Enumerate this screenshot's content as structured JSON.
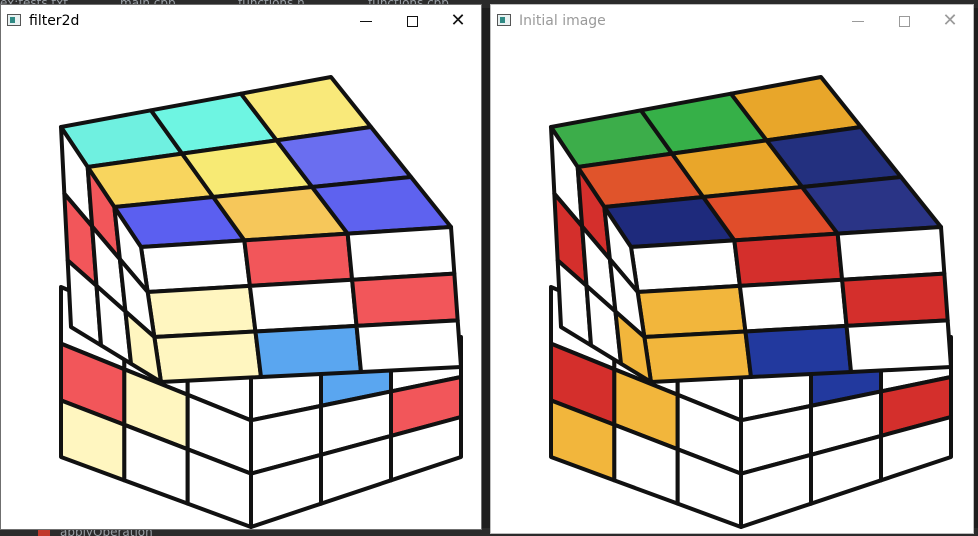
{
  "background": {
    "ide_tabs": [
      "ex:tests.txt",
      "main.cpp",
      "functions.h",
      "functions.cpp"
    ],
    "bottom_label": "applyOperation"
  },
  "windows": [
    {
      "title": "filter2d",
      "controls": {
        "minimize": "minimize",
        "maximize": "maximize",
        "close": "close"
      },
      "colors": {
        "top": [
          "#6ff0e0",
          "#6ef5e2",
          "#f9e97a",
          "#f8d55e",
          "#f7ea74",
          "#6a6ef0",
          "#5b5ff0",
          "#f6c75a",
          "#5e62ef"
        ],
        "front": "#fff6c0",
        "accent_red": "#f2565a",
        "accent_blue": "#5aa6f0"
      }
    },
    {
      "title": "Initial image",
      "controls": {
        "minimize": "minimize",
        "maximize": "maximize",
        "close": "close"
      },
      "colors": {
        "top": [
          "#3cad4a",
          "#36b048",
          "#e8a62a",
          "#e0542b",
          "#e9a62a",
          "#23307f",
          "#1e2a7c",
          "#e04d2a",
          "#2a3486"
        ],
        "front": "#f2b63c",
        "accent_red": "#d42f2c",
        "accent_blue": "#22399e"
      }
    }
  ]
}
